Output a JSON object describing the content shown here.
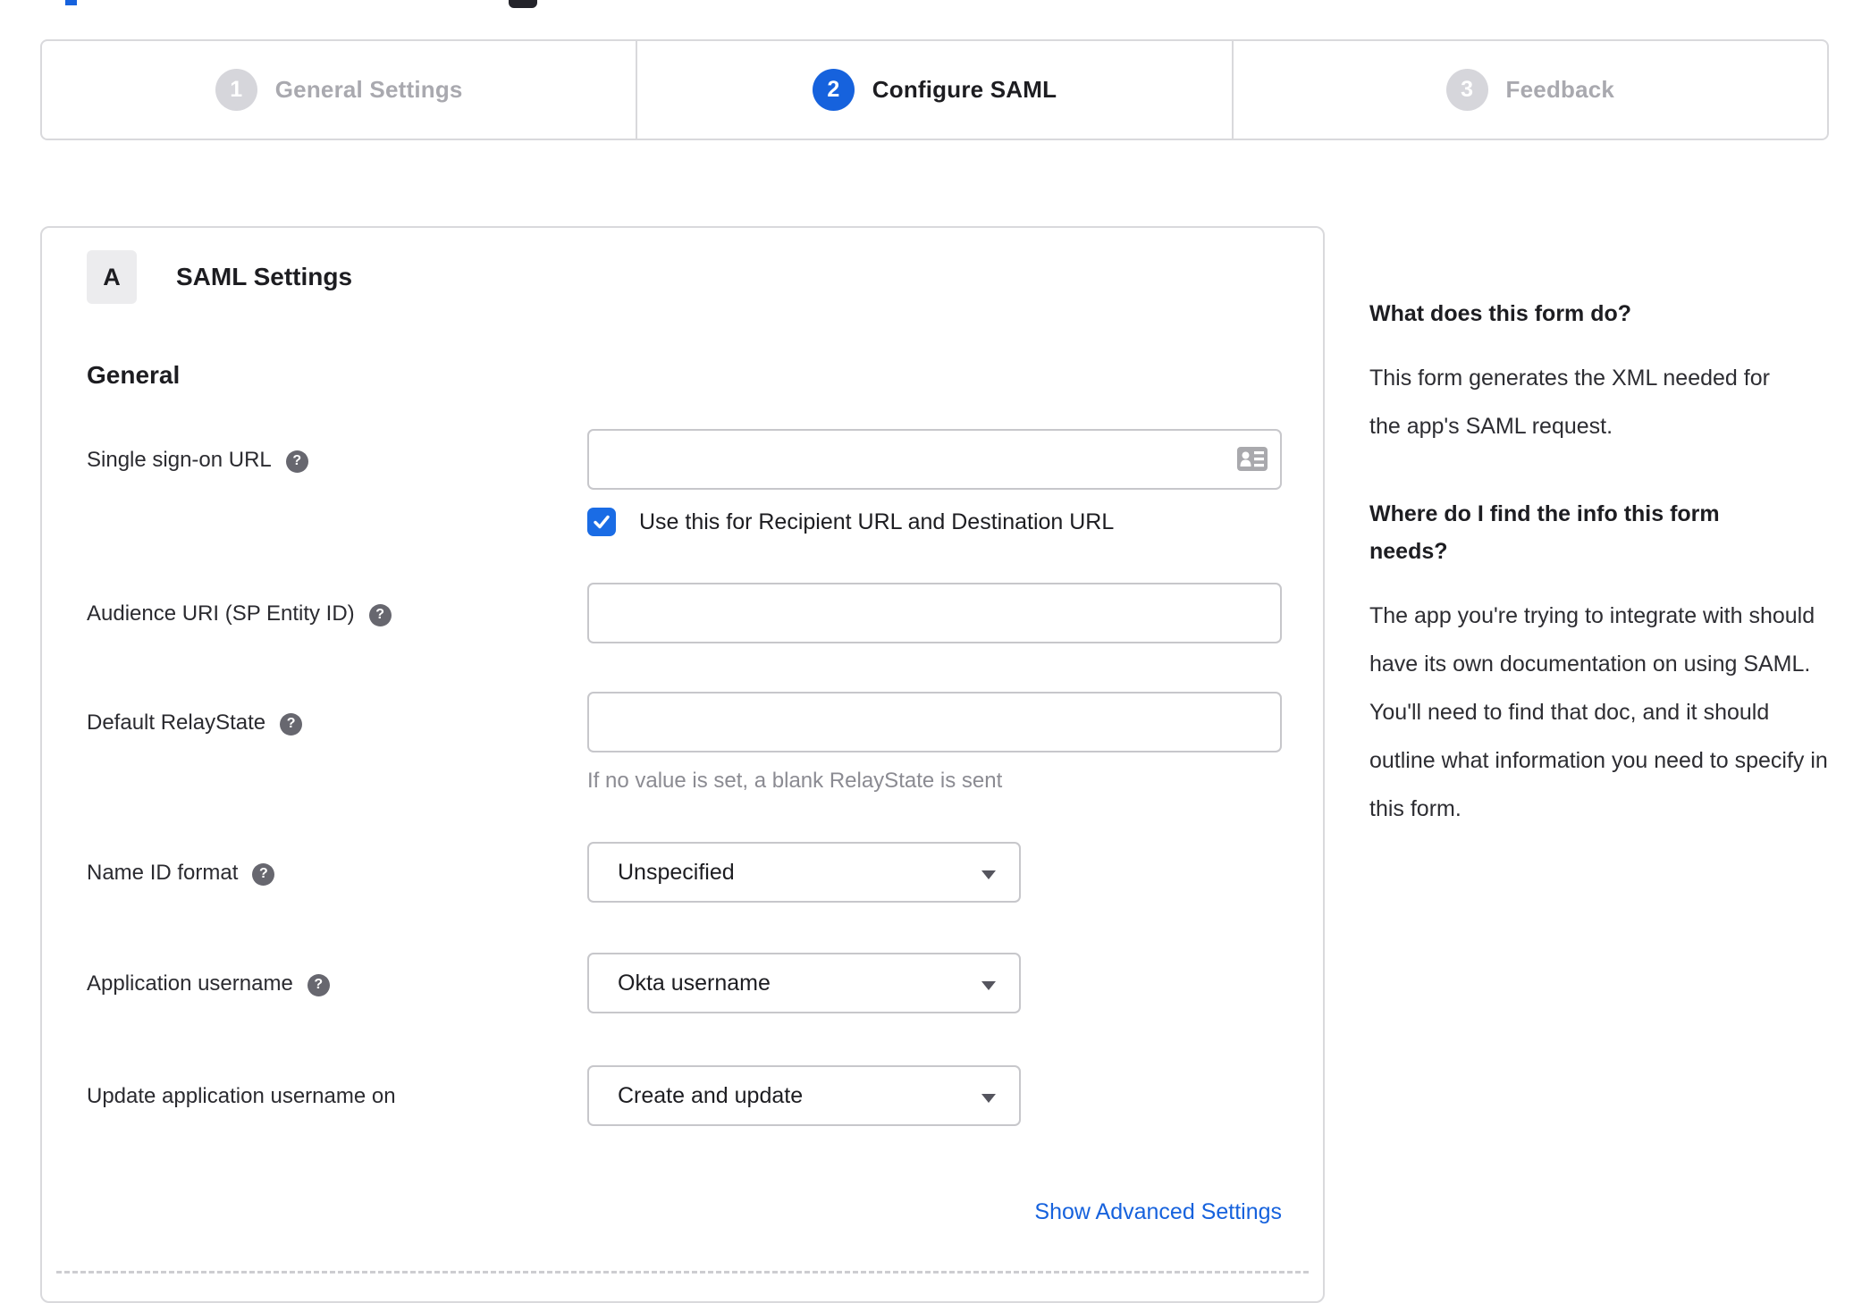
{
  "colors": {
    "accent_blue": "#1662dd",
    "checkbox_blue": "#1a6ce5",
    "link_blue": "#1662dd",
    "inactive_gray": "#a9a9af",
    "border_gray": "#d9d9dc",
    "hint_gray": "#8b8b92"
  },
  "stepper": {
    "steps": [
      {
        "number": "1",
        "label": "General Settings",
        "active": false
      },
      {
        "number": "2",
        "label": "Configure SAML",
        "active": true
      },
      {
        "number": "3",
        "label": "Feedback",
        "active": false
      }
    ]
  },
  "panel": {
    "badge": "A",
    "title": "SAML Settings",
    "section_heading": "General",
    "fields": [
      {
        "label": "Single sign-on URL",
        "has_help": true,
        "type": "text",
        "value": "",
        "trailing_icon": "contact-card-icon",
        "checkbox": {
          "checked": true,
          "label": "Use this for Recipient URL and Destination URL"
        }
      },
      {
        "label": "Audience URI (SP Entity ID)",
        "has_help": true,
        "type": "text",
        "value": ""
      },
      {
        "label": "Default RelayState",
        "has_help": true,
        "type": "text",
        "value": "",
        "hint": "If no value is set, a blank RelayState is sent"
      },
      {
        "label": "Name ID format",
        "has_help": true,
        "type": "select",
        "value": "Unspecified"
      },
      {
        "label": "Application username",
        "has_help": true,
        "type": "select",
        "value": "Okta username"
      },
      {
        "label": "Update application username on",
        "has_help": false,
        "type": "select",
        "value": "Create and update"
      }
    ],
    "help_glyph": "?",
    "advanced_link": "Show Advanced Settings"
  },
  "sidebar": {
    "sections": [
      {
        "heading": "What does this form do?",
        "body": "This form generates the XML needed for the app's SAML request."
      },
      {
        "heading": "Where do I find the info this form needs?",
        "body": "The app you're trying to integrate with should have its own documentation on using SAML. You'll need to find that doc, and it should outline what information you need to specify in this form."
      }
    ]
  }
}
